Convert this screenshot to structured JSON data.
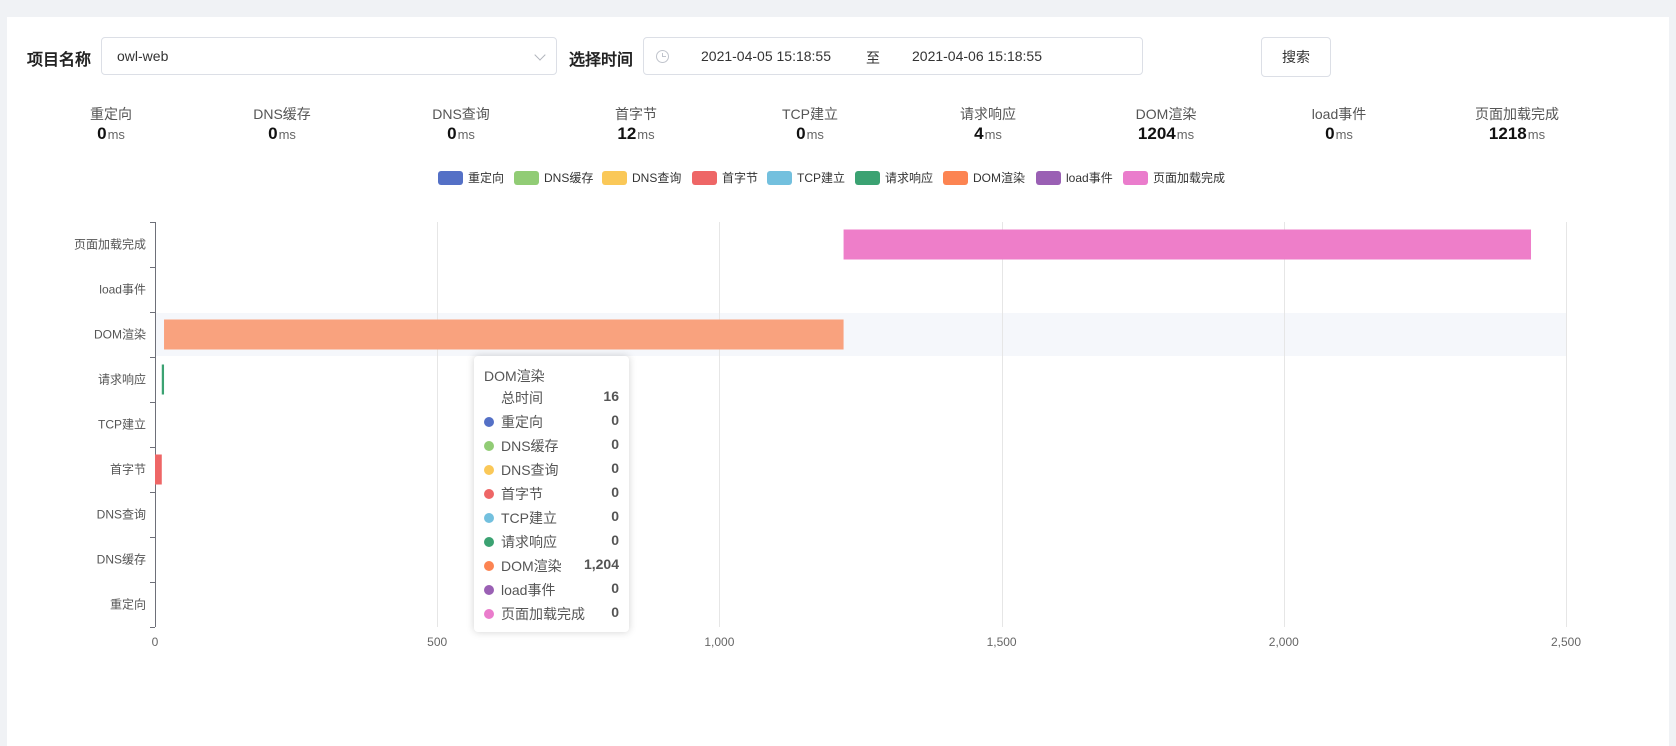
{
  "form": {
    "project_label": "项目名称",
    "project_value": "owl-web",
    "time_label": "选择时间",
    "start_time": "2021-04-05 15:18:55",
    "range_separator": "至",
    "end_time": "2021-04-06 15:18:55",
    "search_label": "搜索"
  },
  "stats": [
    {
      "label": "重定向",
      "value": "0",
      "unit": "ms"
    },
    {
      "label": "DNS缓存",
      "value": "0",
      "unit": "ms"
    },
    {
      "label": "DNS查询",
      "value": "0",
      "unit": "ms"
    },
    {
      "label": "首字节",
      "value": "12",
      "unit": "ms"
    },
    {
      "label": "TCP建立",
      "value": "0",
      "unit": "ms"
    },
    {
      "label": "请求响应",
      "value": "4",
      "unit": "ms"
    },
    {
      "label": "DOM渲染",
      "value": "1204",
      "unit": "ms"
    },
    {
      "label": "load事件",
      "value": "0",
      "unit": "ms"
    },
    {
      "label": "页面加载完成",
      "value": "1218",
      "unit": "ms"
    }
  ],
  "legend": [
    {
      "name": "重定向",
      "color": "#5470c6"
    },
    {
      "name": "DNS缓存",
      "color": "#91cc75"
    },
    {
      "name": "DNS查询",
      "color": "#fac858"
    },
    {
      "name": "首字节",
      "color": "#ee6666"
    },
    {
      "name": "TCP建立",
      "color": "#73c0de"
    },
    {
      "name": "请求响应",
      "color": "#3ba272"
    },
    {
      "name": "DOM渲染",
      "color": "#fc8452"
    },
    {
      "name": "load事件",
      "color": "#9a60b4"
    },
    {
      "name": "页面加载完成",
      "color": "#ea7ccc"
    }
  ],
  "chart_data": {
    "type": "bar",
    "orientation": "horizontal-gantt",
    "categories": [
      "重定向",
      "DNS缓存",
      "DNS查询",
      "首字节",
      "TCP建立",
      "请求响应",
      "DOM渲染",
      "load事件",
      "页面加载完成"
    ],
    "bars": [
      {
        "category": "重定向",
        "start": 0,
        "duration": 0,
        "color": "#5470c6"
      },
      {
        "category": "DNS缓存",
        "start": 0,
        "duration": 0,
        "color": "#91cc75"
      },
      {
        "category": "DNS查询",
        "start": 0,
        "duration": 0,
        "color": "#fac858"
      },
      {
        "category": "首字节",
        "start": 0,
        "duration": 12,
        "color": "#ee6666"
      },
      {
        "category": "TCP建立",
        "start": 12,
        "duration": 0,
        "color": "#73c0de"
      },
      {
        "category": "请求响应",
        "start": 12,
        "duration": 4,
        "color": "#3ba272"
      },
      {
        "category": "DOM渲染",
        "start": 16,
        "duration": 1204,
        "color": "#f9a27e"
      },
      {
        "category": "load事件",
        "start": 1220,
        "duration": 0,
        "color": "#9a60b4"
      },
      {
        "category": "页面加载完成",
        "start": 1220,
        "duration": 1218,
        "color": "#ee7ec9"
      }
    ],
    "xlim": [
      0,
      2500
    ],
    "xticks": [
      0,
      500,
      1000,
      1500,
      2000,
      2500
    ],
    "xtick_labels": [
      "0",
      "500",
      "1,000",
      "1,500",
      "2,000",
      "2,500"
    ],
    "grid": true,
    "highlighted_category": "DOM渲染"
  },
  "tooltip": {
    "title": "DOM渲染",
    "total_label": "总时间",
    "total_value": "16",
    "rows": [
      {
        "name": "重定向",
        "value": "0",
        "color": "#5470c6"
      },
      {
        "name": "DNS缓存",
        "value": "0",
        "color": "#91cc75"
      },
      {
        "name": "DNS查询",
        "value": "0",
        "color": "#fac858"
      },
      {
        "name": "首字节",
        "value": "0",
        "color": "#ee6666"
      },
      {
        "name": "TCP建立",
        "value": "0",
        "color": "#73c0de"
      },
      {
        "name": "请求响应",
        "value": "0",
        "color": "#3ba272"
      },
      {
        "name": "DOM渲染",
        "value": "1,204",
        "color": "#fc8452"
      },
      {
        "name": "load事件",
        "value": "0",
        "color": "#9a60b4"
      },
      {
        "name": "页面加载完成",
        "value": "0",
        "color": "#ea7ccc"
      }
    ]
  }
}
